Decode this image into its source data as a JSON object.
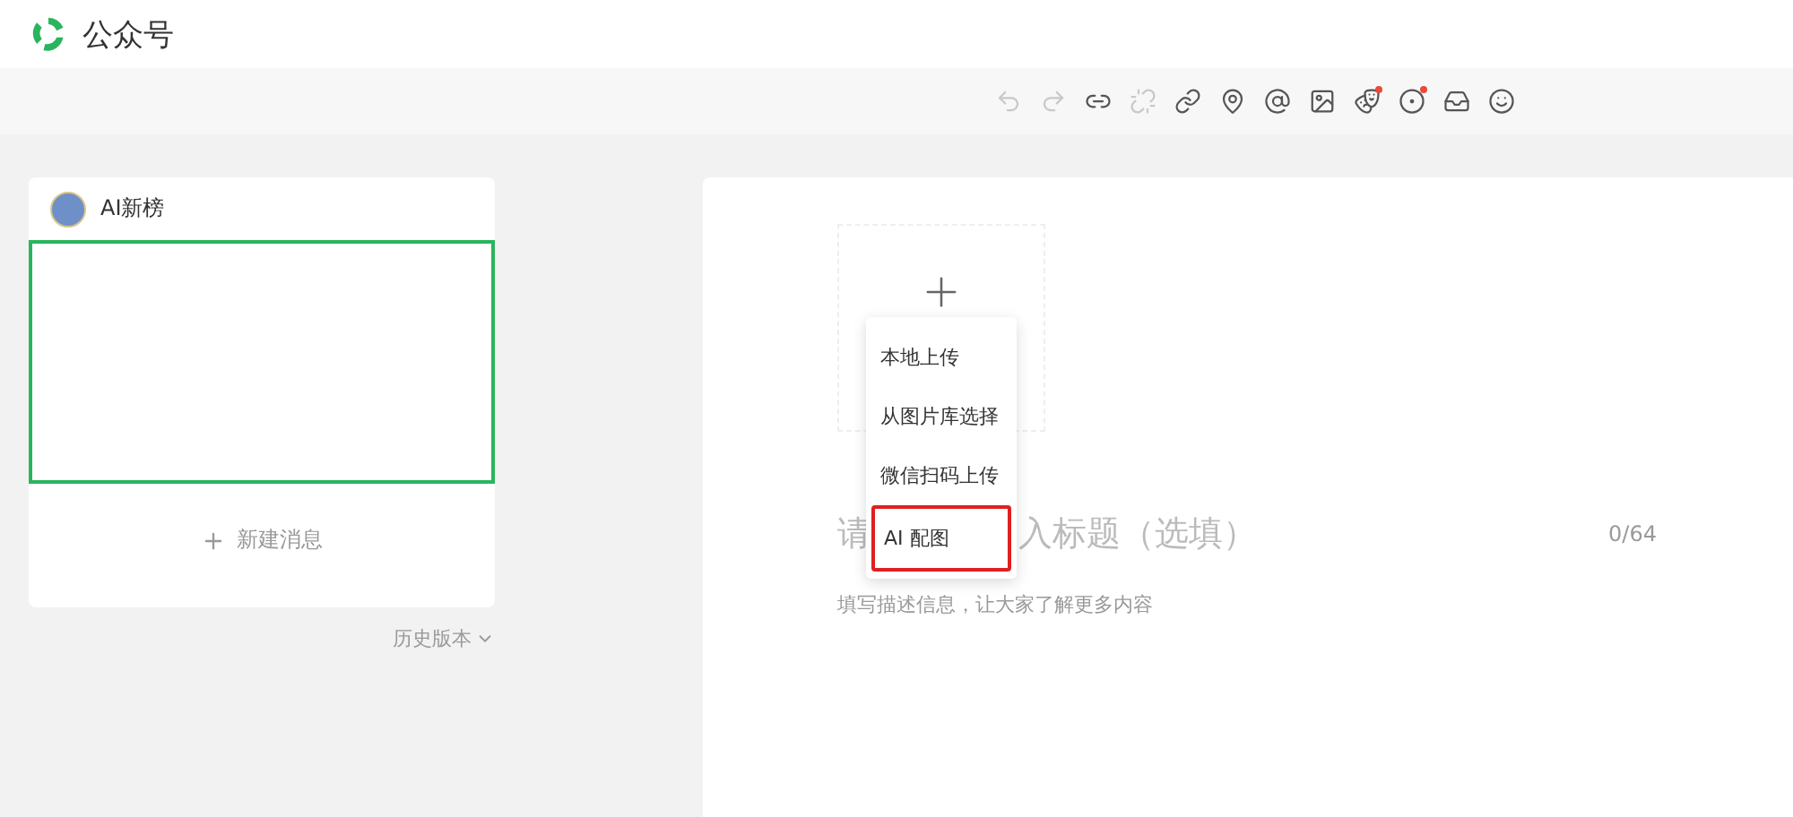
{
  "header": {
    "brand": "公众号"
  },
  "toolbar": [
    {
      "kind": "undo",
      "disabled": true,
      "dot": false
    },
    {
      "kind": "redo",
      "disabled": true,
      "dot": false
    },
    {
      "kind": "link",
      "disabled": false,
      "dot": false
    },
    {
      "kind": "unlink",
      "disabled": true,
      "dot": false
    },
    {
      "kind": "link-circle",
      "disabled": false,
      "dot": false
    },
    {
      "kind": "location",
      "disabled": false,
      "dot": false
    },
    {
      "kind": "at",
      "disabled": false,
      "dot": false
    },
    {
      "kind": "image",
      "disabled": false,
      "dot": false
    },
    {
      "kind": "mask",
      "disabled": false,
      "dot": true
    },
    {
      "kind": "target",
      "disabled": false,
      "dot": true
    },
    {
      "kind": "inbox",
      "disabled": false,
      "dot": false
    },
    {
      "kind": "smile",
      "disabled": false,
      "dot": false
    }
  ],
  "sidebar": {
    "account": "AI新榜",
    "new_message": "新建消息",
    "history": "历史版本"
  },
  "editor": {
    "upload_menu": [
      {
        "label": "本地上传",
        "highlighted": false
      },
      {
        "label": "从图片库选择",
        "highlighted": false
      },
      {
        "label": "微信扫码上传",
        "highlighted": false
      },
      {
        "label": "AI 配图",
        "highlighted": true
      }
    ],
    "title_visible_parts": [
      "请",
      "入标题（选填）"
    ],
    "title_count": "0/64",
    "description_placeholder": "填写描述信息，让大家了解更多内容"
  }
}
